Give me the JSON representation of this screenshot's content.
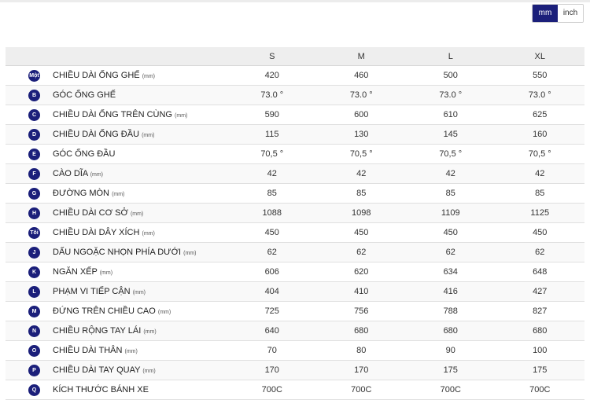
{
  "unit_toggle": {
    "mm_label": "mm",
    "inch_label": "inch",
    "selected": "mm"
  },
  "table": {
    "sizes": [
      "S",
      "M",
      "L",
      "XL"
    ],
    "rows": [
      {
        "badge": "Một",
        "label": "CHIỀU DÀI ỐNG GHẾ",
        "unit": "(mm)",
        "values": [
          "420",
          "460",
          "500",
          "550"
        ]
      },
      {
        "badge": "B",
        "label": "GÓC ỐNG GHẾ",
        "unit": "",
        "values": [
          "73.0 °",
          "73.0 °",
          "73.0 °",
          "73.0 °"
        ]
      },
      {
        "badge": "C",
        "label": "CHIỀU DÀI ỐNG TRÊN CÙNG",
        "unit": "(mm)",
        "values": [
          "590",
          "600",
          "610",
          "625"
        ]
      },
      {
        "badge": "D",
        "label": "CHIỀU DÀI ỐNG ĐẦU",
        "unit": "(mm)",
        "values": [
          "115",
          "130",
          "145",
          "160"
        ]
      },
      {
        "badge": "E",
        "label": "GÓC ỐNG ĐẦU",
        "unit": "",
        "values": [
          "70,5 °",
          "70,5 °",
          "70,5 °",
          "70,5 °"
        ]
      },
      {
        "badge": "F",
        "label": "CÀO DĨA",
        "unit": "(mm)",
        "values": [
          "42",
          "42",
          "42",
          "42"
        ]
      },
      {
        "badge": "G",
        "label": "ĐƯỜNG MÒN",
        "unit": "(mm)",
        "values": [
          "85",
          "85",
          "85",
          "85"
        ]
      },
      {
        "badge": "H",
        "label": "CHIỀU DÀI CƠ SỞ",
        "unit": "(mm)",
        "values": [
          "1088",
          "1098",
          "1109",
          "1125"
        ]
      },
      {
        "badge": "Tôi",
        "label": "CHIỀU DÀI DÂY XÍCH",
        "unit": "(mm)",
        "values": [
          "450",
          "450",
          "450",
          "450"
        ]
      },
      {
        "badge": "J",
        "label": "DẤU NGOẶC NHỌN PHÍA DƯỚI",
        "unit": "(mm)",
        "values": [
          "62",
          "62",
          "62",
          "62"
        ]
      },
      {
        "badge": "K",
        "label": "NGĂN XẾP",
        "unit": "(mm)",
        "values": [
          "606",
          "620",
          "634",
          "648"
        ]
      },
      {
        "badge": "L",
        "label": "PHẠM VI TIẾP CẬN",
        "unit": "(mm)",
        "values": [
          "404",
          "410",
          "416",
          "427"
        ]
      },
      {
        "badge": "M",
        "label": "ĐỨNG TRÊN CHIỀU CAO",
        "unit": "(mm)",
        "values": [
          "725",
          "756",
          "788",
          "827"
        ]
      },
      {
        "badge": "N",
        "label": "CHIỀU RỘNG TAY LÁI",
        "unit": "(mm)",
        "values": [
          "640",
          "680",
          "680",
          "680"
        ]
      },
      {
        "badge": "O",
        "label": "CHIỀU DÀI THÂN",
        "unit": "(mm)",
        "values": [
          "70",
          "80",
          "90",
          "100"
        ]
      },
      {
        "badge": "P",
        "label": "CHIỀU DÀI TAY QUAY",
        "unit": "(mm)",
        "values": [
          "170",
          "170",
          "175",
          "175"
        ]
      },
      {
        "badge": "Q",
        "label": "KÍCH THƯỚC BÁNH XE",
        "unit": "",
        "values": [
          "700C",
          "700C",
          "700C",
          "700C"
        ]
      }
    ]
  },
  "colors": {
    "accent": "#1b1f7a",
    "header_bg": "#eeeeee"
  }
}
